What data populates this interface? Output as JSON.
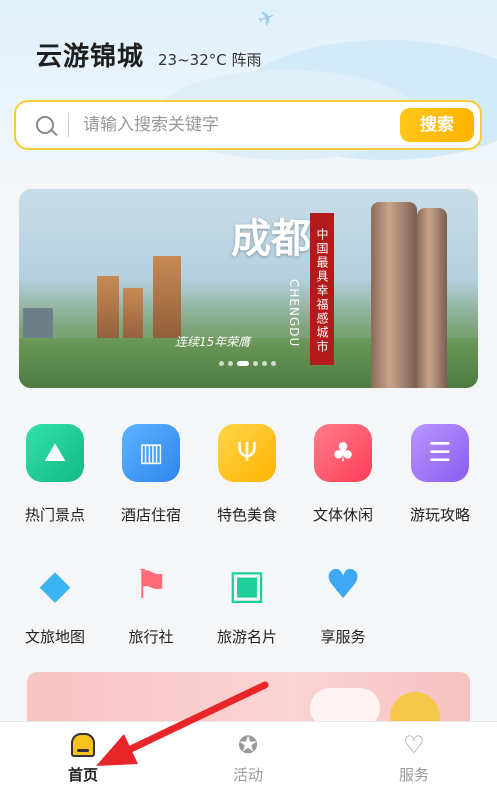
{
  "header": {
    "title": "云游锦城",
    "weather": "23~32°C 阵雨"
  },
  "search": {
    "placeholder": "请输入搜索关键字",
    "button_label": "搜索"
  },
  "banner": {
    "headline": "成都",
    "subtitle": "CHENGDU",
    "slogan_vertical": "中国最具幸福感城市",
    "slogan": "连续15年荣膺"
  },
  "services": [
    {
      "label": "热门景点",
      "icon": "mountain-photo-icon",
      "color": "#1fcf9a"
    },
    {
      "label": "酒店住宿",
      "icon": "hotel-building-icon",
      "color": "#3e9cf5"
    },
    {
      "label": "特色美食",
      "icon": "fork-spoon-icon",
      "color": "#ffc21a"
    },
    {
      "label": "文体休闲",
      "icon": "palm-beach-icon",
      "color": "#ff5a6e"
    },
    {
      "label": "游玩攻略",
      "icon": "guide-document-icon",
      "color": "#a57ef7"
    },
    {
      "label": "文旅地图",
      "icon": "map-gem-icon",
      "color": "#3db4f2"
    },
    {
      "label": "旅行社",
      "icon": "flag-star-icon",
      "color": "#ff6a7a"
    },
    {
      "label": "旅游名片",
      "icon": "card-badge-icon",
      "color": "#1fcf9a"
    },
    {
      "label": "享服务",
      "icon": "heart-icon",
      "color": "#3ea8f5"
    }
  ],
  "tabbar": {
    "items": [
      {
        "label": "首页",
        "icon": "home-icon"
      },
      {
        "label": "活动",
        "icon": "star-circle-icon"
      },
      {
        "label": "服务",
        "icon": "heart-outline-icon"
      }
    ]
  },
  "colors": {
    "accent": "#ffc21a",
    "search_border": "#f5cf3a",
    "annotation_arrow": "#e8262a"
  }
}
